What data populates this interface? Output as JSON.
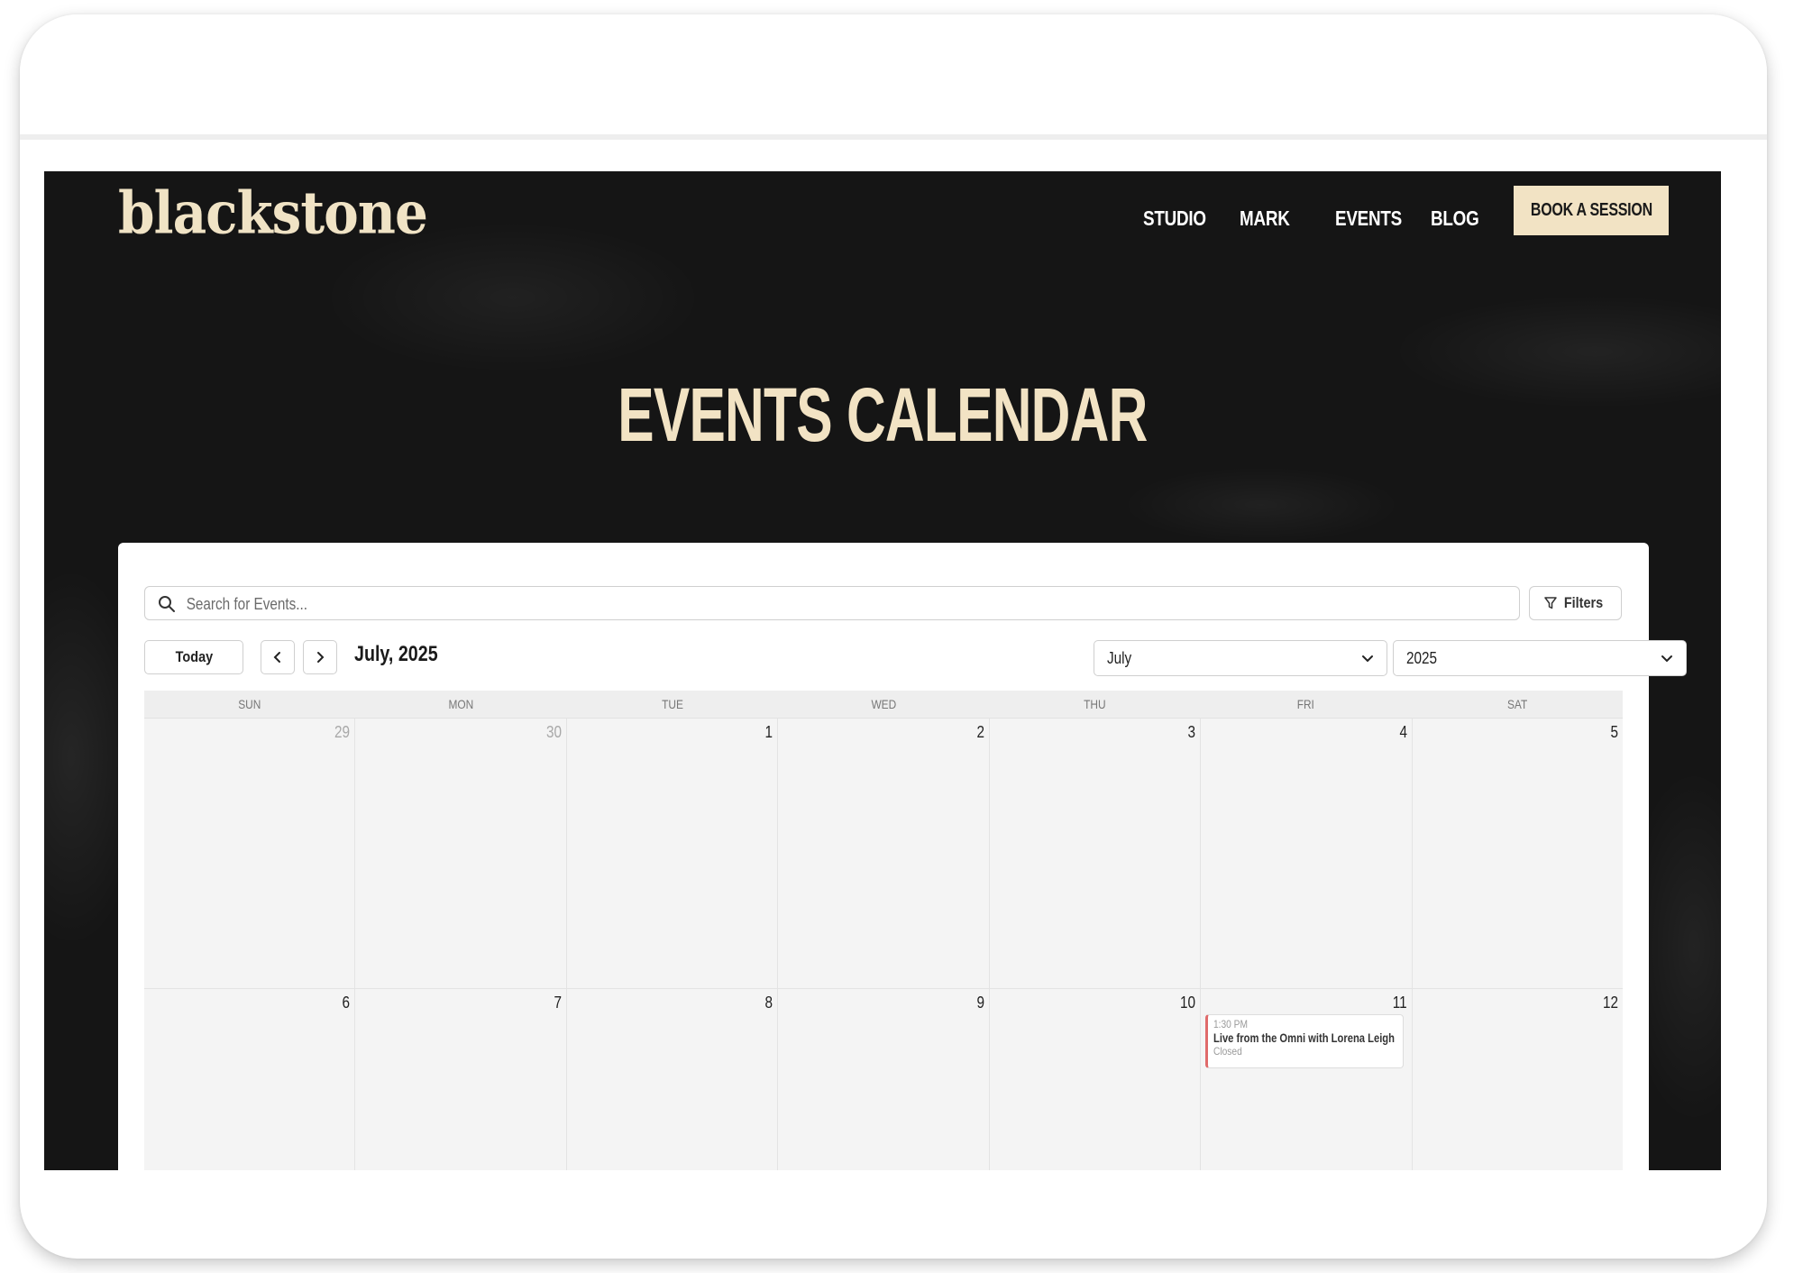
{
  "brand": {
    "logo": "blackstone",
    "accent_cream": "#f2e3c4",
    "background_dark": "#151515",
    "event_accent": "#e06a6a"
  },
  "nav": {
    "items": [
      "STUDIO",
      "MARK",
      "EVENTS",
      "BLOG"
    ],
    "cta": "BOOK A SESSION"
  },
  "hero": {
    "title": "EVENTS CALENDAR"
  },
  "calendar": {
    "search_placeholder": "Search for Events...",
    "filters_label": "Filters",
    "today_label": "Today",
    "current_label": "July, 2025",
    "month_select": "July",
    "year_select": "2025",
    "days_of_week": [
      "SUN",
      "MON",
      "TUE",
      "WED",
      "THU",
      "FRI",
      "SAT"
    ],
    "weeks": [
      [
        "29",
        "30",
        "1",
        "2",
        "3",
        "4",
        "5"
      ],
      [
        "6",
        "7",
        "8",
        "9",
        "10",
        "11",
        "12"
      ]
    ],
    "event": {
      "time": "1:30 PM",
      "title": "Live from the Omni with Lorena Leigh",
      "status": "Closed"
    }
  }
}
